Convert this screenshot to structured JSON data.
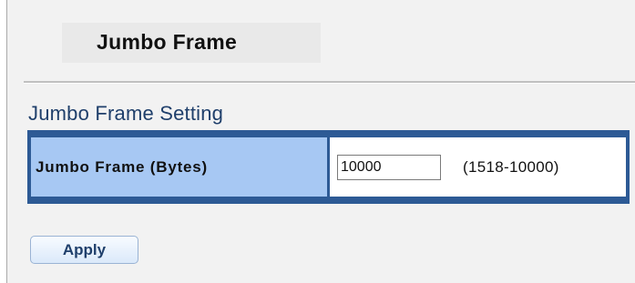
{
  "page": {
    "title": "Jumbo Frame"
  },
  "section": {
    "title": "Jumbo Frame Setting"
  },
  "setting": {
    "label": "Jumbo Frame (Bytes)",
    "value": "10000",
    "range": "(1518-10000)"
  },
  "actions": {
    "apply_label": "Apply"
  },
  "colors": {
    "table_border": "#2d5a95",
    "label_background": "#a7c8f3",
    "section_title": "#1f3f6b"
  }
}
